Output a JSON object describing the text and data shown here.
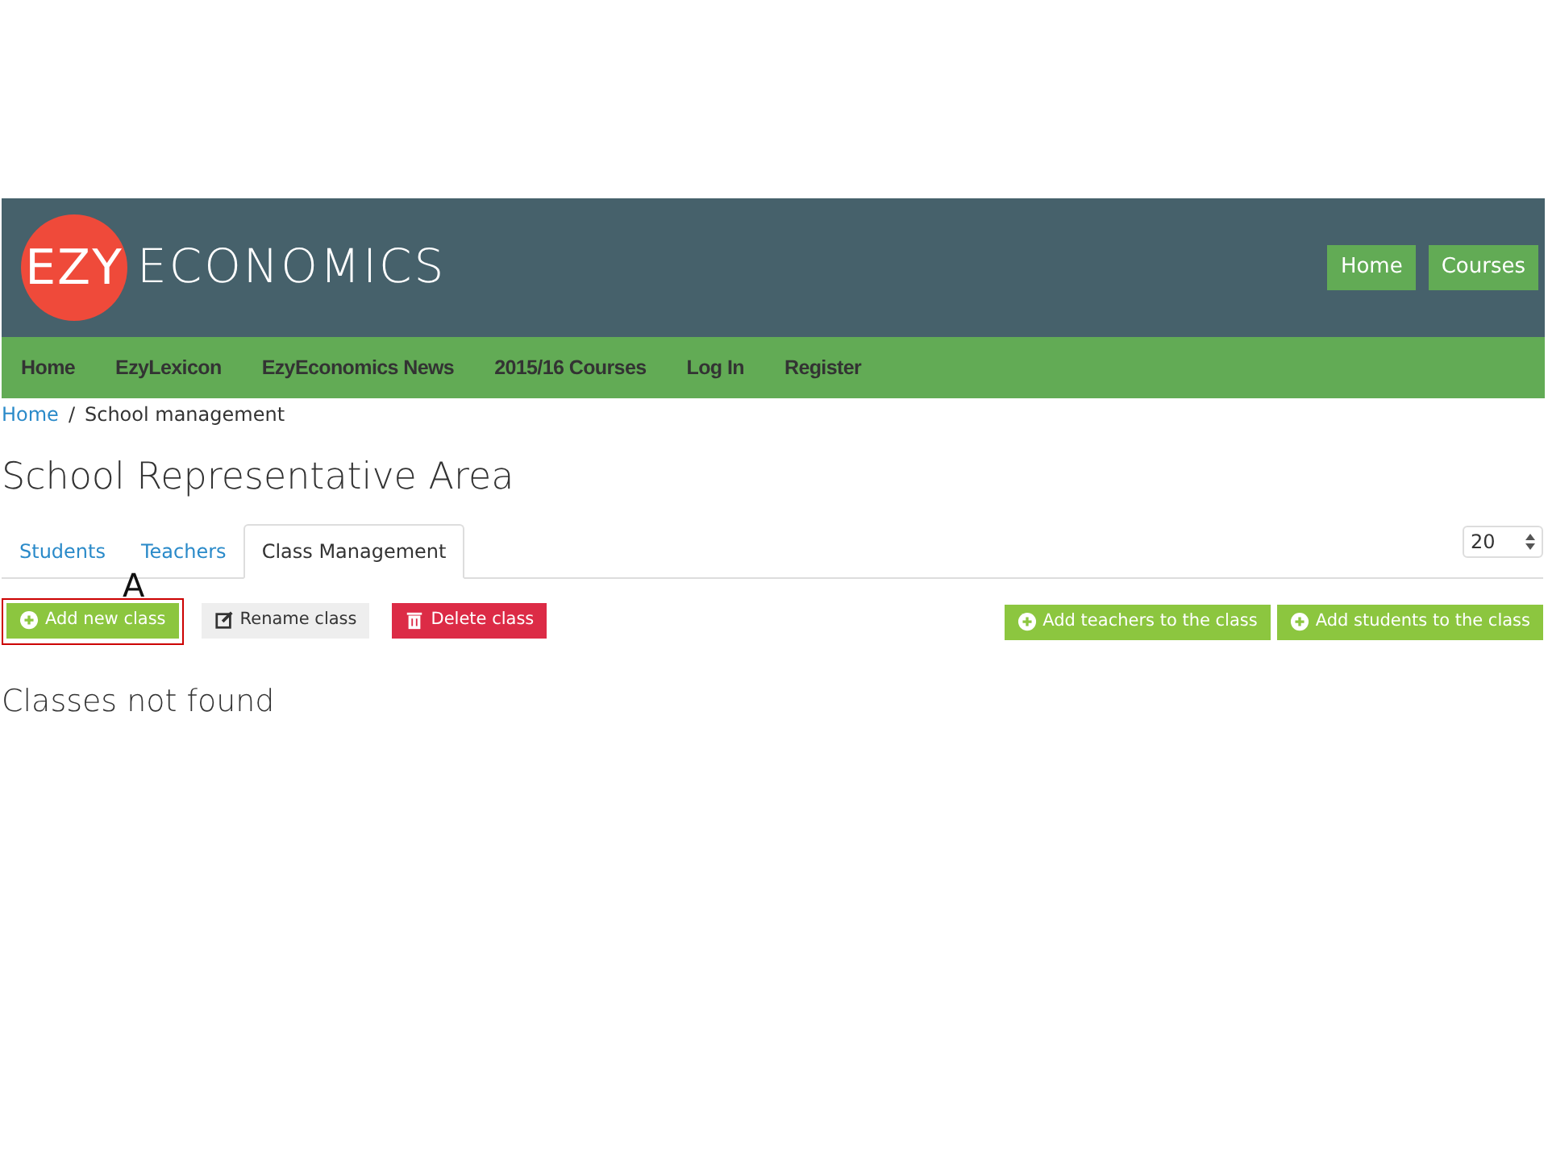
{
  "logo": {
    "badge": "EZY",
    "text": "ECONOMICS"
  },
  "header_buttons": [
    "Home",
    "Courses"
  ],
  "nav": [
    "Home",
    "EzyLexicon",
    "EzyEconomics News",
    "2015/16 Courses",
    "Log In",
    "Register"
  ],
  "breadcrumb": [
    {
      "label": "Home",
      "kind": "link"
    },
    {
      "label": "/",
      "kind": "separator"
    },
    {
      "label": "School management",
      "kind": "current"
    }
  ],
  "title": "School Representative Area",
  "tabs": [
    {
      "label": "Students",
      "selected": false
    },
    {
      "label": "Teachers",
      "selected": false
    },
    {
      "label": "Class Management",
      "selected": true
    }
  ],
  "page_size": {
    "value": "20"
  },
  "annotation": {
    "label": "A"
  },
  "toolbar_left": [
    {
      "label": "Add new class",
      "kind": "add",
      "highlighted": true
    },
    {
      "label": "Rename class",
      "kind": "rename",
      "highlighted": false
    },
    {
      "label": "Delete class",
      "kind": "delete",
      "highlighted": false
    }
  ],
  "toolbar_right": [
    {
      "label": "Add teachers to the class",
      "kind": "add"
    },
    {
      "label": "Add students to the class",
      "kind": "add"
    }
  ],
  "message": "Classes not found"
}
